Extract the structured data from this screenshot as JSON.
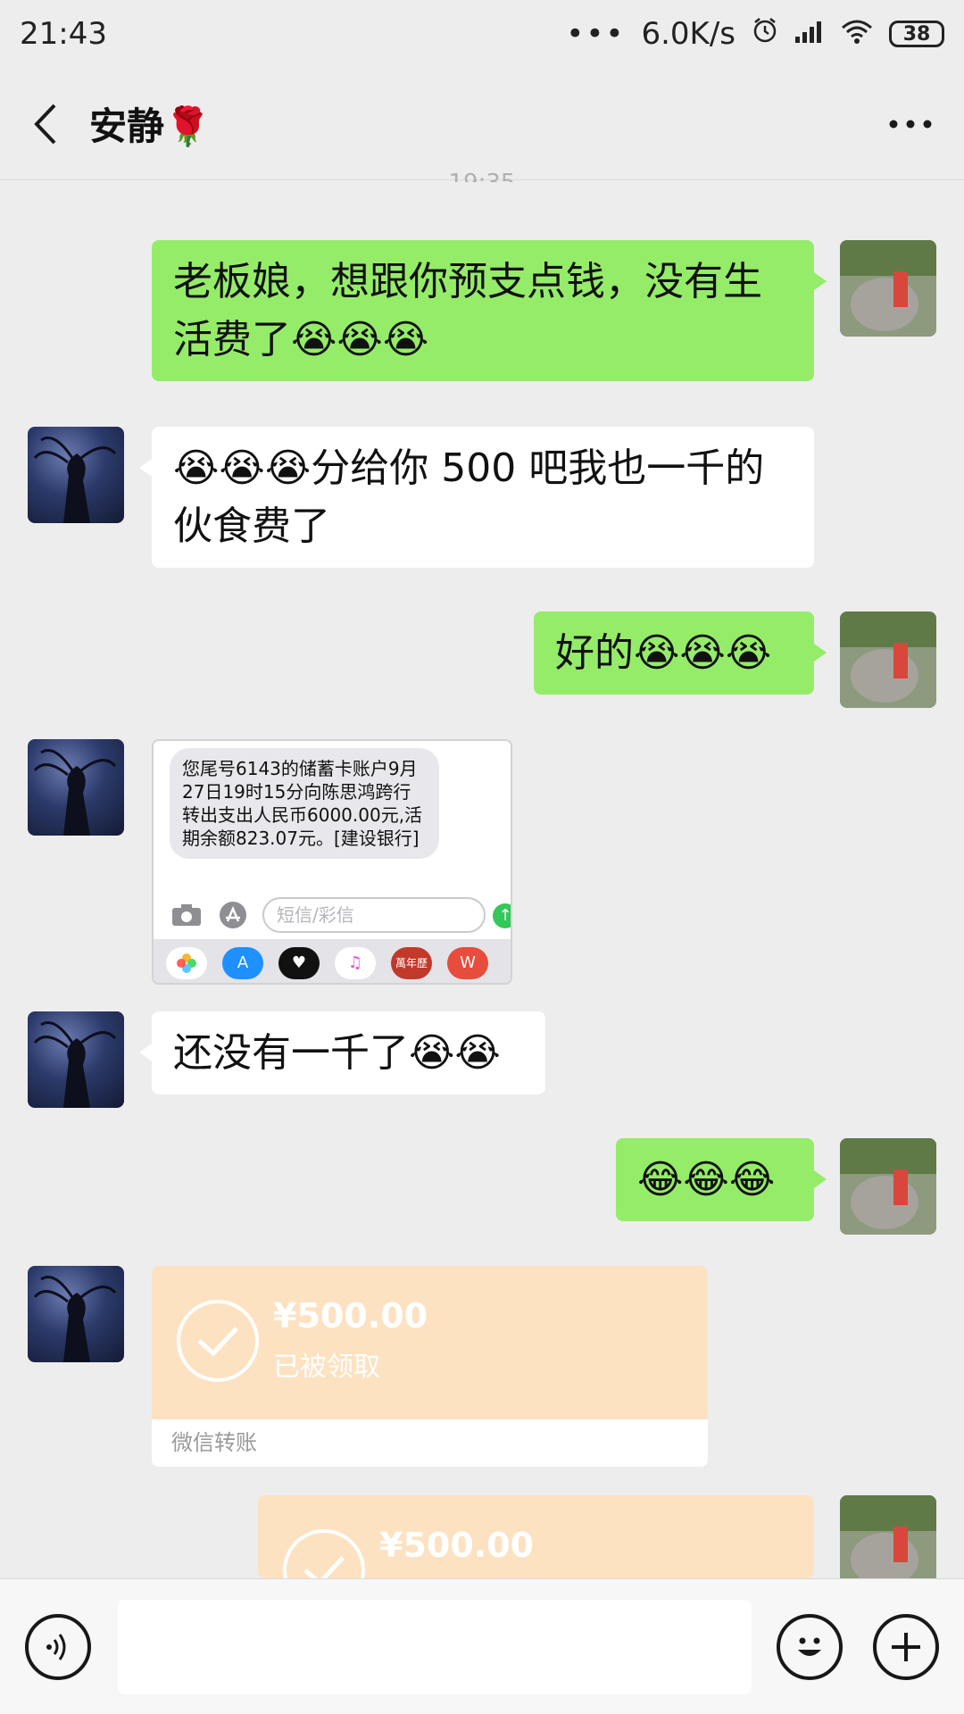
{
  "status_bar": {
    "time": "21:43",
    "dots": "•••",
    "speed": "6.0K/s",
    "battery": "38"
  },
  "header": {
    "title": "安静🌹"
  },
  "timestamp": "19:35",
  "messages": {
    "m1": "老板娘，想跟你预支点钱，没有生活费了😭😭😭",
    "m2": "😭😭😭分给你 500 吧我也一千的伙食费了",
    "m3": "好的😭😭😭",
    "m5": "还没有一千了😭😭",
    "m6": "😂😂😂"
  },
  "sms": {
    "text": "您尾号6143的储蓄卡账户9月27日19时15分向陈思鸿跨行转出支出人民币6000.00元,活期余额823.07元。[建设银行]",
    "placeholder": "短信/彩信",
    "dock_label": "萬年歷"
  },
  "transfer1": {
    "amount": "¥500.00",
    "status": "已被领取",
    "label": "微信转账"
  },
  "transfer2": {
    "amount": "¥500.00"
  }
}
